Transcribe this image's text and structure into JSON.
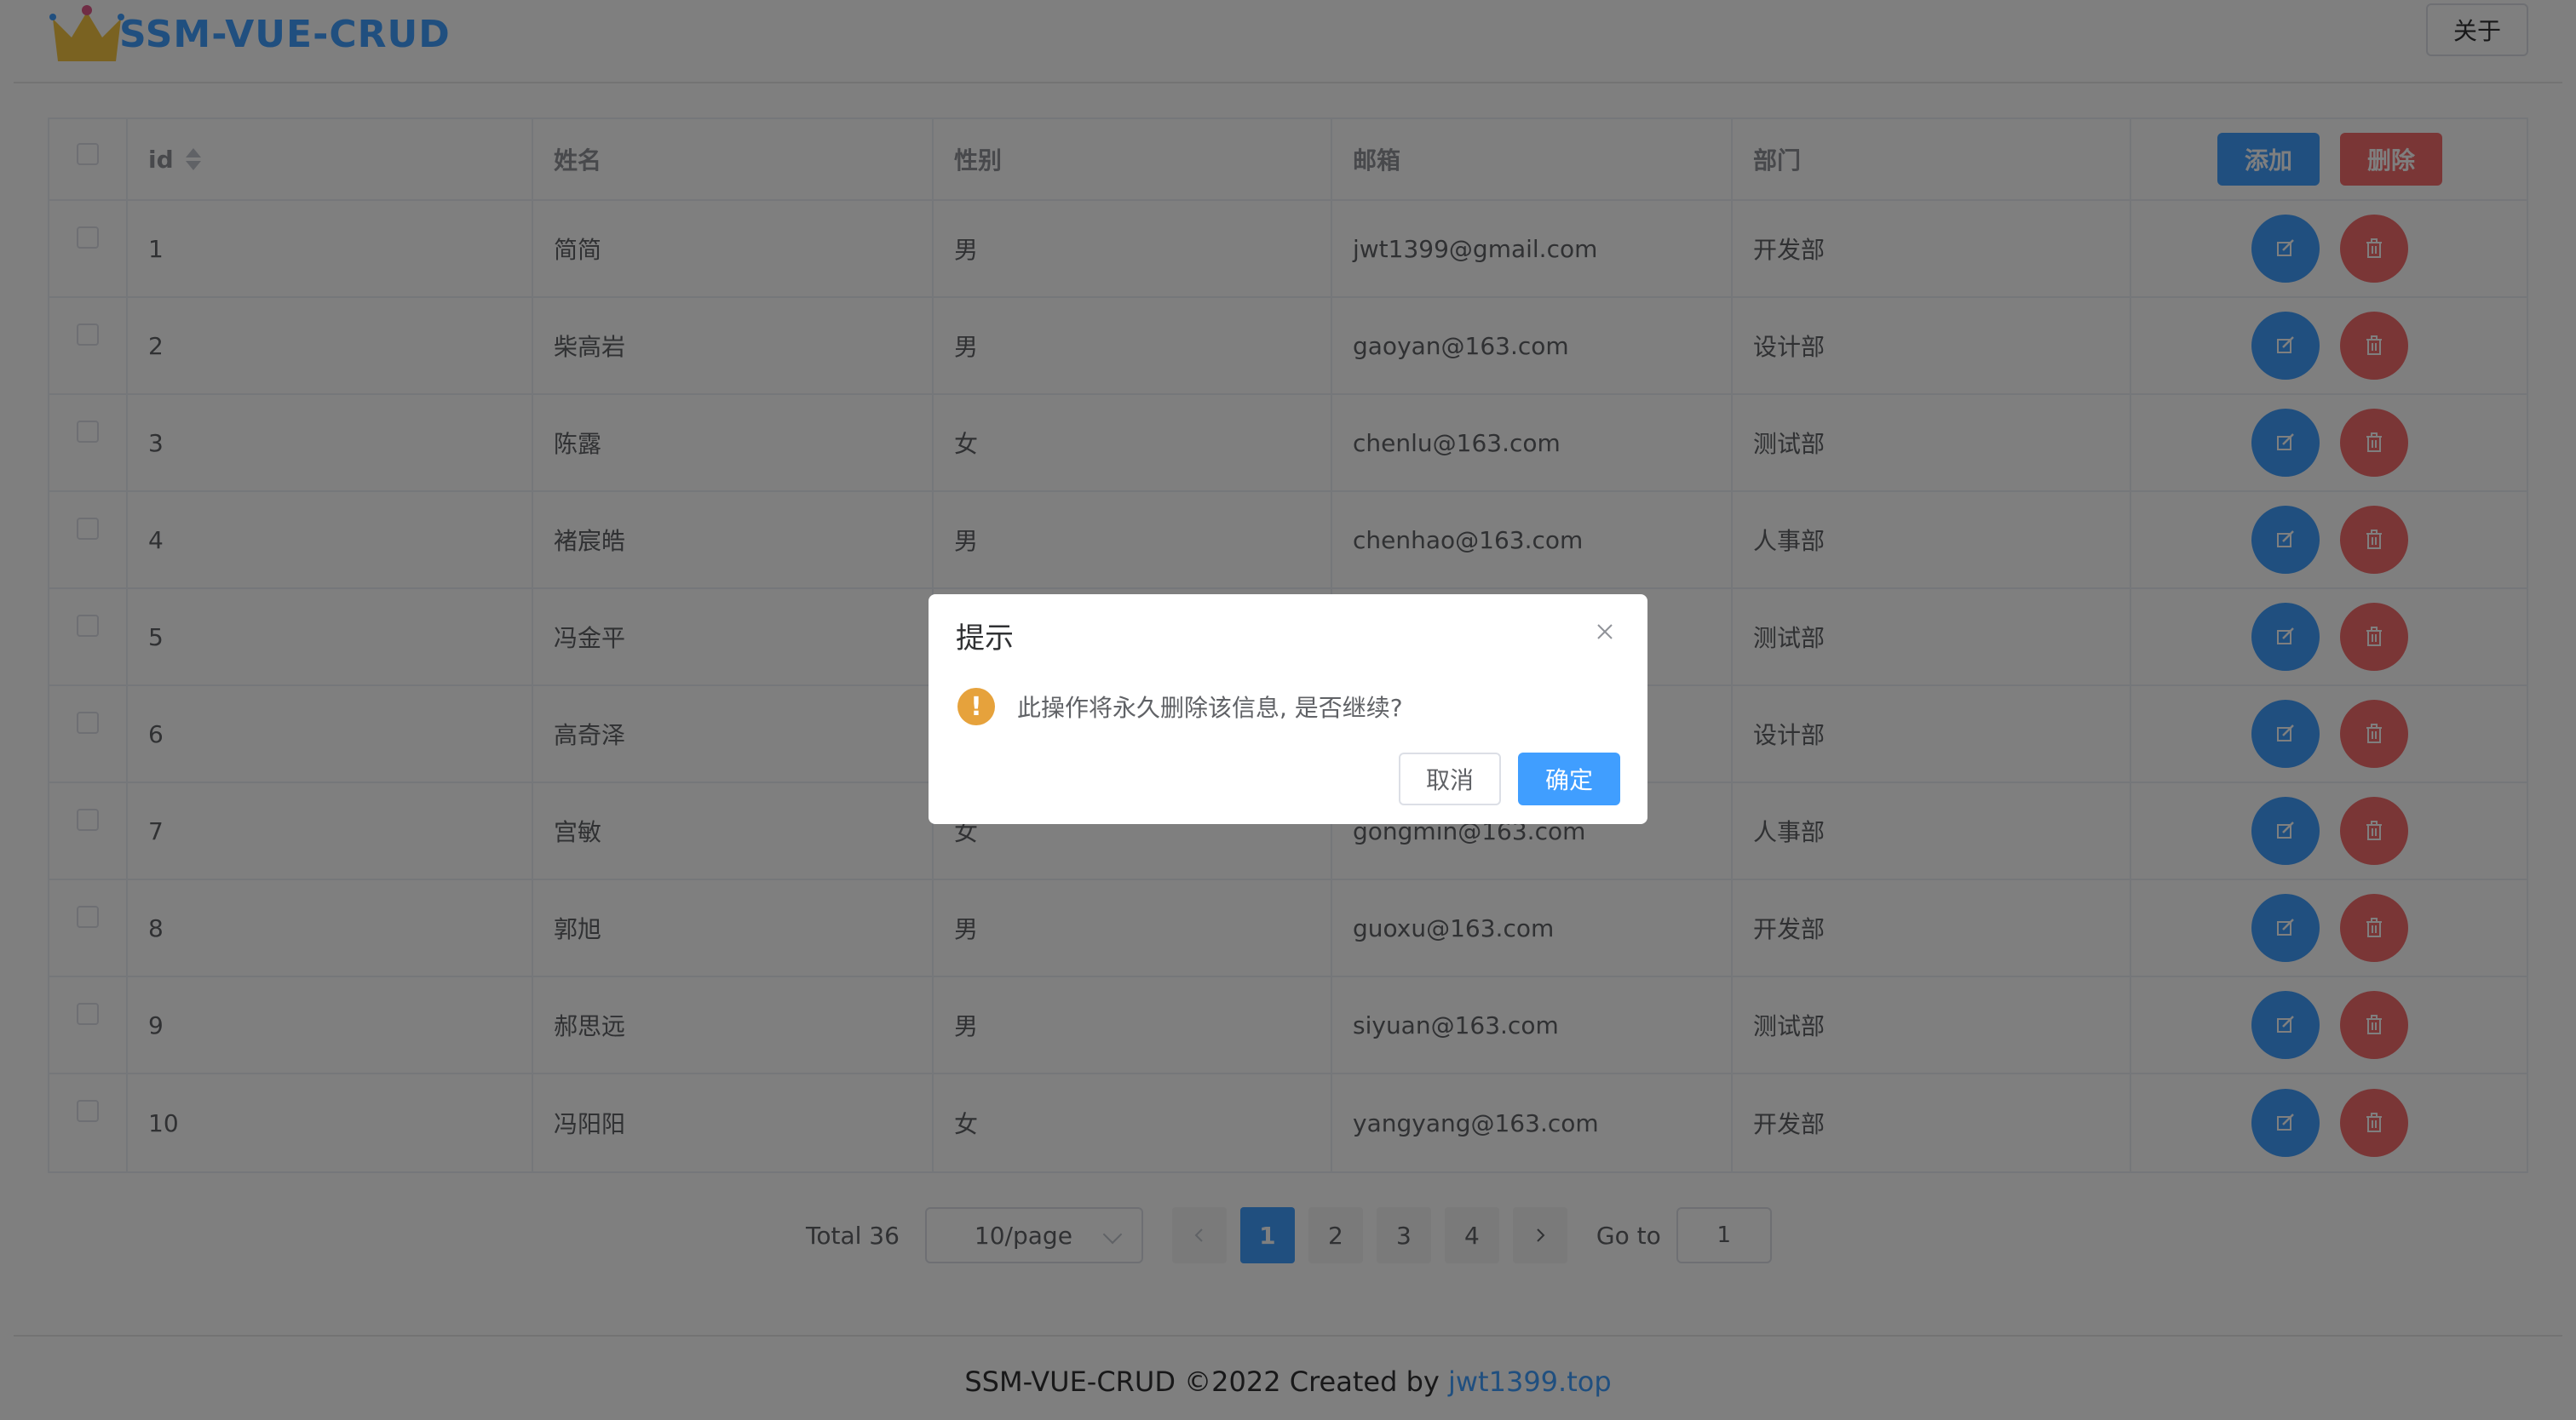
{
  "header": {
    "brand": "SSM-VUE-CRUD",
    "about_label": "关于"
  },
  "table": {
    "columns": [
      "id",
      "姓名",
      "性别",
      "邮箱",
      "部门"
    ],
    "add_label": "添加",
    "delete_label": "删除",
    "rows": [
      {
        "id": "1",
        "name": "简简",
        "gender": "男",
        "email": "jwt1399@gmail.com",
        "dept": "开发部"
      },
      {
        "id": "2",
        "name": "柴高岩",
        "gender": "男",
        "email": "gaoyan@163.com",
        "dept": "设计部"
      },
      {
        "id": "3",
        "name": "陈露",
        "gender": "女",
        "email": "chenlu@163.com",
        "dept": "测试部"
      },
      {
        "id": "4",
        "name": "褚宸皓",
        "gender": "男",
        "email": "chenhao@163.com",
        "dept": "人事部"
      },
      {
        "id": "5",
        "name": "冯金平",
        "gender": "",
        "email": "",
        "dept": "测试部"
      },
      {
        "id": "6",
        "name": "高奇泽",
        "gender": "",
        "email": "",
        "dept": "设计部"
      },
      {
        "id": "7",
        "name": "宫敏",
        "gender": "女",
        "email": "gongmin@163.com",
        "dept": "人事部"
      },
      {
        "id": "8",
        "name": "郭旭",
        "gender": "男",
        "email": "guoxu@163.com",
        "dept": "开发部"
      },
      {
        "id": "9",
        "name": "郝思远",
        "gender": "男",
        "email": "siyuan@163.com",
        "dept": "测试部"
      },
      {
        "id": "10",
        "name": "冯阳阳",
        "gender": "女",
        "email": "yangyang@163.com",
        "dept": "开发部"
      }
    ]
  },
  "pagination": {
    "total_label": "Total 36",
    "page_size": "10/page",
    "pages": [
      "1",
      "2",
      "3",
      "4"
    ],
    "current_page": "1",
    "goto_label": "Go to",
    "goto_value": "1"
  },
  "footer": {
    "text": "SSM-VUE-CRUD ©2022 Created by ",
    "link": "jwt1399.top"
  },
  "dialog": {
    "title": "提示",
    "message": "此操作将永久删除该信息, 是否继续?",
    "cancel_label": "取消",
    "confirm_label": "确定"
  },
  "colors": {
    "primary": "#409eff",
    "danger": "#f56c6c",
    "warning": "#e6a23c"
  }
}
